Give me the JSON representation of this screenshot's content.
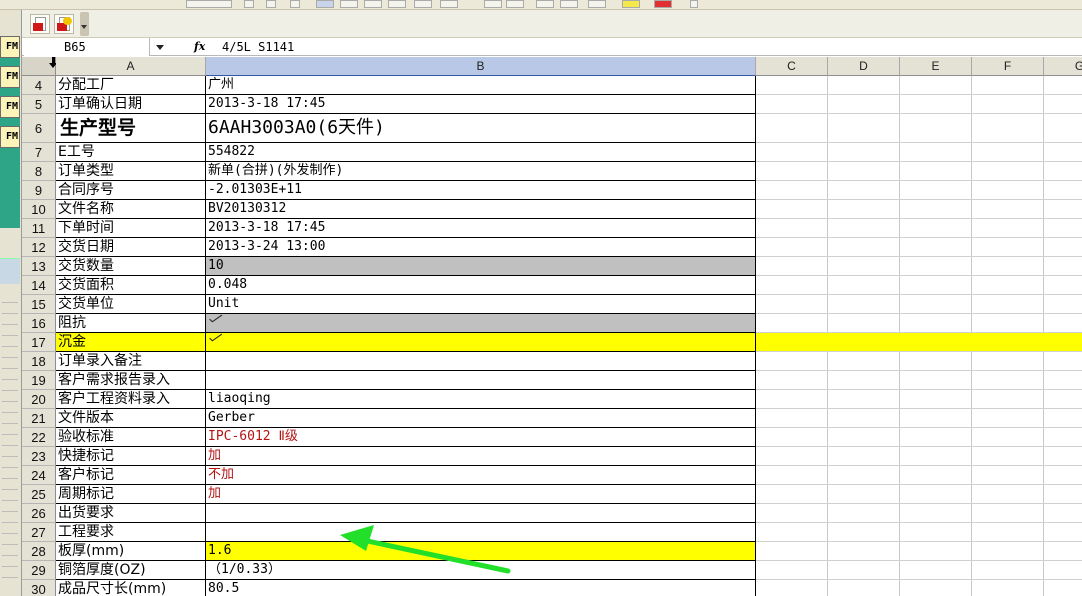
{
  "formula_bar": {
    "name_box": "B65",
    "fx_label": "fx",
    "formula": "4/5L S1141"
  },
  "left_strip": {
    "chips": [
      "FM",
      "FM",
      "FM",
      "FM"
    ]
  },
  "columns": [
    "A",
    "B",
    "C",
    "D",
    "E",
    "F",
    "G"
  ],
  "rows": [
    {
      "num": "4",
      "label": "分配工厂",
      "value": "广州"
    },
    {
      "num": "5",
      "label": "订单确认日期",
      "value": "2013-3-18 17:45"
    },
    {
      "num": "6",
      "label": "生产型号",
      "value": "6AAH3003A0(6天件)"
    },
    {
      "num": "7",
      "label": "E工号",
      "value": "554822"
    },
    {
      "num": "8",
      "label": "订单类型",
      "value": "新单(合拼)(外发制作)"
    },
    {
      "num": "9",
      "label": "合同序号",
      "value": "-2.01303E+11"
    },
    {
      "num": "10",
      "label": "文件名称",
      "value": "BV20130312"
    },
    {
      "num": "11",
      "label": "下单时间",
      "value": "2013-3-18 17:45"
    },
    {
      "num": "12",
      "label": "交货日期",
      "value": "2013-3-24 13:00"
    },
    {
      "num": "13",
      "label": "交货数量",
      "value": "10"
    },
    {
      "num": "14",
      "label": "交货面积",
      "value": "0.048"
    },
    {
      "num": "15",
      "label": "交货单位",
      "value": "Unit"
    },
    {
      "num": "16",
      "label": "阻抗",
      "value": ""
    },
    {
      "num": "17",
      "label": "沉金",
      "value": ""
    },
    {
      "num": "18",
      "label": "订单录入备注",
      "value": ""
    },
    {
      "num": "19",
      "label": "客户需求报告录入",
      "value": ""
    },
    {
      "num": "20",
      "label": "客户工程资料录入",
      "value": "liaoqing"
    },
    {
      "num": "21",
      "label": "文件版本",
      "value": "Gerber"
    },
    {
      "num": "22",
      "label": "验收标准",
      "value": "IPC-6012 Ⅱ级"
    },
    {
      "num": "23",
      "label": "快捷标记",
      "value": "加"
    },
    {
      "num": "24",
      "label": "客户标记",
      "value": "不加"
    },
    {
      "num": "25",
      "label": "周期标记",
      "value": "加"
    },
    {
      "num": "26",
      "label": "出货要求",
      "value": ""
    },
    {
      "num": "27",
      "label": "工程要求",
      "value": ""
    },
    {
      "num": "28",
      "label": "板厚(mm)",
      "value": "1.6"
    },
    {
      "num": "29",
      "label": "铜箔厚度(OZ)",
      "value": "（1/0.33）"
    },
    {
      "num": "30",
      "label": "成品尺寸长(mm)",
      "value": "80.5"
    }
  ],
  "colors": {
    "highlight_yellow": "#ffff00",
    "shade_gray": "#c0c0c0",
    "red_text": "#b41414",
    "arrow_green": "#22e02a"
  }
}
